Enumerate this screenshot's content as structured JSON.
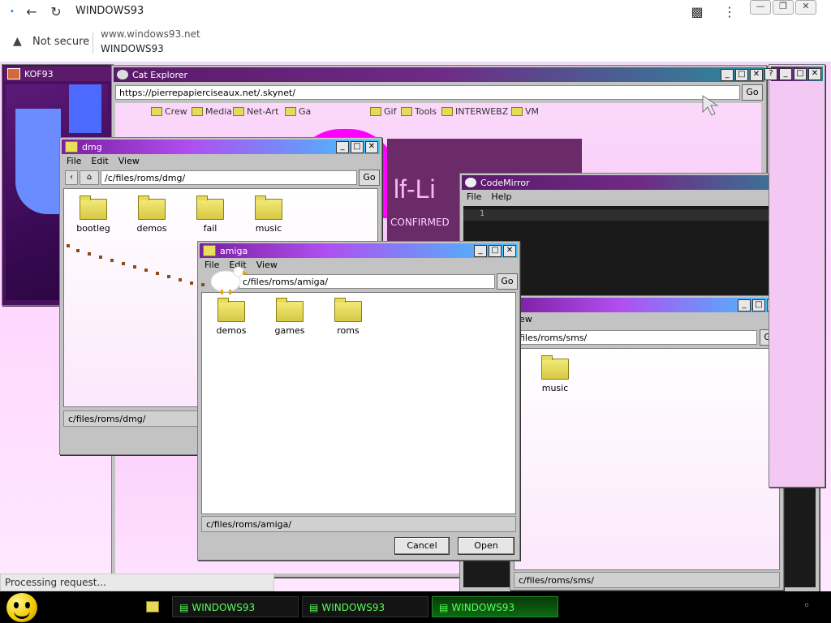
{
  "browser": {
    "tab_title": "WINDOWS93",
    "security_label": "Not secure",
    "url": "www.windows93.net",
    "page_title": "WINDOWS93",
    "status": "Processing request..."
  },
  "kof": {
    "title": "KOF93"
  },
  "cat_explorer": {
    "title": "Cat Explorer",
    "address": "https://pierrepapierciseaux.net/.skynet/",
    "go_label": "Go",
    "bookmarks": [
      "Crew",
      "Media",
      "Net-Art",
      "Ga",
      "Gif",
      "Tools",
      "INTERWEBZ",
      "VM"
    ],
    "page_text_fragment": "lf-Li",
    "confirmed_label": "CONFIRMED"
  },
  "dmg": {
    "title": "dmg",
    "menu": [
      "File",
      "Edit",
      "View"
    ],
    "address": "/c/files/roms/dmg/",
    "go_label": "Go",
    "folders": [
      "bootleg",
      "demos",
      "fail",
      "music"
    ],
    "status": "c/files/roms/dmg/"
  },
  "codemirror": {
    "title": "CodeMirror",
    "menu": [
      "File",
      "Help"
    ],
    "line_number": "1"
  },
  "amiga": {
    "title": "amiga",
    "menu": [
      "File",
      "Edit",
      "View"
    ],
    "address": "c/files/roms/amiga/",
    "go_label": "Go",
    "folders": [
      "demos",
      "games",
      "roms"
    ],
    "status": "c/files/roms/amiga/",
    "cancel_label": "Cancel",
    "open_label": "Open"
  },
  "sms": {
    "menu_fragment": "iew",
    "address": "files/roms/sms/",
    "go_label": "Go",
    "folders": [
      "music"
    ],
    "status": "c/files/roms/sms/"
  },
  "taskbar": {
    "items": [
      "WINDOWS93",
      "WINDOWS93",
      "WINDOWS93"
    ]
  }
}
